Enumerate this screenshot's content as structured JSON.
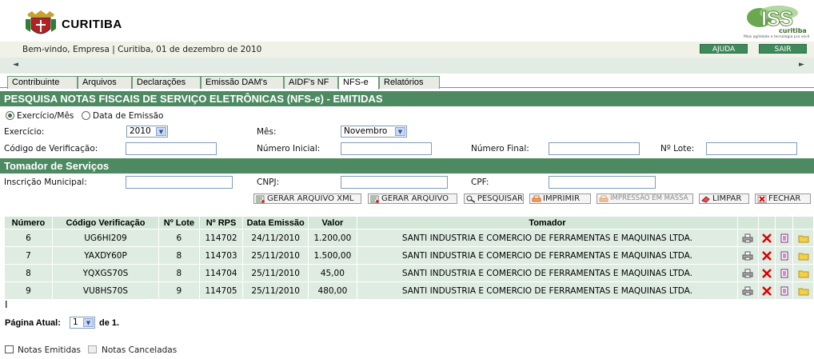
{
  "header": {
    "city_name": "CURITIBA",
    "iss_brand": "ISS",
    "iss_sub": "curitiba",
    "iss_tagline": "Mais agilidade e tecnologia pra você"
  },
  "welcome": {
    "text": "Bem-vindo, Empresa | Curitiba, 01 de dezembro de 2010"
  },
  "top_buttons": {
    "help": "AJUDA",
    "exit": "SAIR"
  },
  "scroll": {
    "left": "◄",
    "right": "►"
  },
  "tabs": [
    "Contribuinte",
    "Arquivos",
    "Declarações",
    "Emissão DAM's",
    "AIDF's NF",
    "NFS-e",
    "Relatórios"
  ],
  "active_tab": "NFS-e",
  "search_section": {
    "title": "PESQUISA NOTAS FISCAIS DE SERVIÇO ELETRÔNICAS (NFS-e) - EMITIDAS",
    "radio_period": "Exercício/Mês",
    "radio_date": "Data de Emissão",
    "exercicio_label": "Exercício:",
    "exercicio_value": "2010",
    "mes_label": "Mês:",
    "mes_value": "Novembro",
    "codigo_label": "Código de Verificação:",
    "numero_inicial_label": "Número Inicial:",
    "numero_final_label": "Número Final:",
    "lote_label": "Nº Lote:"
  },
  "tomador_section": {
    "title": "Tomador de Serviços",
    "inscricao_label": "Inscrição Municipal:",
    "cnpj_label": "CNPJ:",
    "cpf_label": "CPF:"
  },
  "actions": {
    "xml": "GERAR ARQUIVO XML",
    "arquivo": "GERAR ARQUIVO",
    "pesquisar": "PESQUISAR",
    "imprimir": "IMPRIMIR",
    "massa": "IMPRESSÃO EM MASSA",
    "limpar": "LIMPAR",
    "fechar": "FECHAR"
  },
  "table": {
    "headers": [
      "Número",
      "Código Verificação",
      "Nº Lote",
      "Nº RPS",
      "Data Emissão",
      "Valor",
      "Tomador"
    ],
    "rows": [
      {
        "numero": "6",
        "codigo": "UG6HI209",
        "lote": "6",
        "rps": "114702",
        "data": "24/11/2010",
        "valor": "1.200,00",
        "tomador": "SANTI INDUSTRIA E COMERCIO DE FERRAMENTAS E MAQUINAS LTDA."
      },
      {
        "numero": "7",
        "codigo": "YAXDY60P",
        "lote": "8",
        "rps": "114703",
        "data": "25/11/2010",
        "valor": "1.500,00",
        "tomador": "SANTI INDUSTRIA E COMERCIO DE FERRAMENTAS E MAQUINAS LTDA."
      },
      {
        "numero": "8",
        "codigo": "YQXGS70S",
        "lote": "8",
        "rps": "114704",
        "data": "25/11/2010",
        "valor": "45,00",
        "tomador": "SANTI INDUSTRIA E COMERCIO DE FERRAMENTAS E MAQUINAS LTDA."
      },
      {
        "numero": "9",
        "codigo": "VU8HS70S",
        "lote": "9",
        "rps": "114705",
        "data": "25/11/2010",
        "valor": "480,00",
        "tomador": "SANTI INDUSTRIA E COMERCIO DE FERRAMENTAS E MAQUINAS LTDA."
      }
    ]
  },
  "cursor_glyph": "I",
  "pagination": {
    "label": "Página Atual:",
    "value": "1",
    "of": "de 1."
  },
  "legend": {
    "emitidas": "Notas Emitidas",
    "canceladas": "Notas Canceladas"
  },
  "colors": {
    "section_green": "#4d8a62",
    "button_green": "#3e8a5c",
    "row_bg": "#dfece2"
  }
}
